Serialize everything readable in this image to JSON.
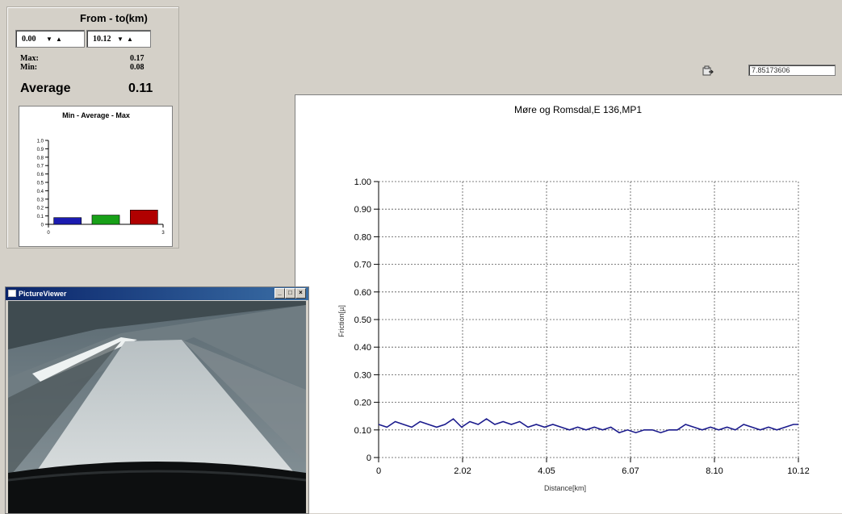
{
  "range": {
    "title": "From - to(km)",
    "from": "0.00",
    "to": "10.12"
  },
  "stats": {
    "max_label": "Max:",
    "max_value": "0.17",
    "min_label": "Min:",
    "min_value": "0.08",
    "average_label": "Average",
    "average_value": "0.11"
  },
  "mini_chart_data": {
    "type": "bar",
    "title": "Min - Average - Max",
    "categories": [
      "Min",
      "Average",
      "Max"
    ],
    "values": [
      0.08,
      0.11,
      0.17
    ],
    "colors": [
      "#1b1bb0",
      "#18a018",
      "#b00000"
    ],
    "yticks": [
      "1.0",
      "0.9",
      "0.8",
      "0.7",
      "0.6",
      "0.5",
      "0.4",
      "0.3",
      "0.2",
      "0.1",
      "0"
    ],
    "xticks": [
      "0",
      "3"
    ],
    "ylim": [
      0,
      1.0
    ]
  },
  "top_input": {
    "value": "7.85173606"
  },
  "chart_data": {
    "type": "line",
    "title": "Møre og Romsdal,E 136,MP1",
    "xlabel": "Distance[km]",
    "ylabel": "Friction[µ]",
    "xlim": [
      0,
      10.12
    ],
    "ylim": [
      0,
      1.0
    ],
    "xticks": [
      "0",
      "2.02",
      "4.05",
      "6.07",
      "8.10",
      "10.12"
    ],
    "yticks": [
      "0",
      "0.10",
      "0.20",
      "0.30",
      "0.40",
      "0.50",
      "0.60",
      "0.70",
      "0.80",
      "0.90",
      "1.00"
    ],
    "grid": true,
    "line_color": "#1a1a8c",
    "series": [
      {
        "x": [
          0,
          0.2,
          0.4,
          0.6,
          0.8,
          1.0,
          1.2,
          1.4,
          1.6,
          1.8,
          2.0,
          2.2,
          2.4,
          2.6,
          2.8,
          3.0,
          3.2,
          3.4,
          3.6,
          3.8,
          4.0,
          4.2,
          4.4,
          4.6,
          4.8,
          5.0,
          5.2,
          5.4,
          5.6,
          5.8,
          6.0,
          6.2,
          6.4,
          6.6,
          6.8,
          7.0,
          7.2,
          7.4,
          7.6,
          7.8,
          8.0,
          8.2,
          8.4,
          8.6,
          8.8,
          9.0,
          9.2,
          9.4,
          9.6,
          9.8,
          10.0,
          10.12
        ],
        "y": [
          0.12,
          0.11,
          0.13,
          0.12,
          0.11,
          0.13,
          0.12,
          0.11,
          0.12,
          0.14,
          0.11,
          0.13,
          0.12,
          0.14,
          0.12,
          0.13,
          0.12,
          0.13,
          0.11,
          0.12,
          0.11,
          0.12,
          0.11,
          0.1,
          0.11,
          0.1,
          0.11,
          0.1,
          0.11,
          0.09,
          0.1,
          0.09,
          0.1,
          0.1,
          0.09,
          0.1,
          0.1,
          0.12,
          0.11,
          0.1,
          0.11,
          0.1,
          0.11,
          0.1,
          0.12,
          0.11,
          0.1,
          0.11,
          0.1,
          0.11,
          0.12,
          0.12
        ]
      }
    ]
  },
  "viewer": {
    "title": "PictureViewer",
    "min_label": "_",
    "max_label": "□",
    "close_label": "×"
  }
}
